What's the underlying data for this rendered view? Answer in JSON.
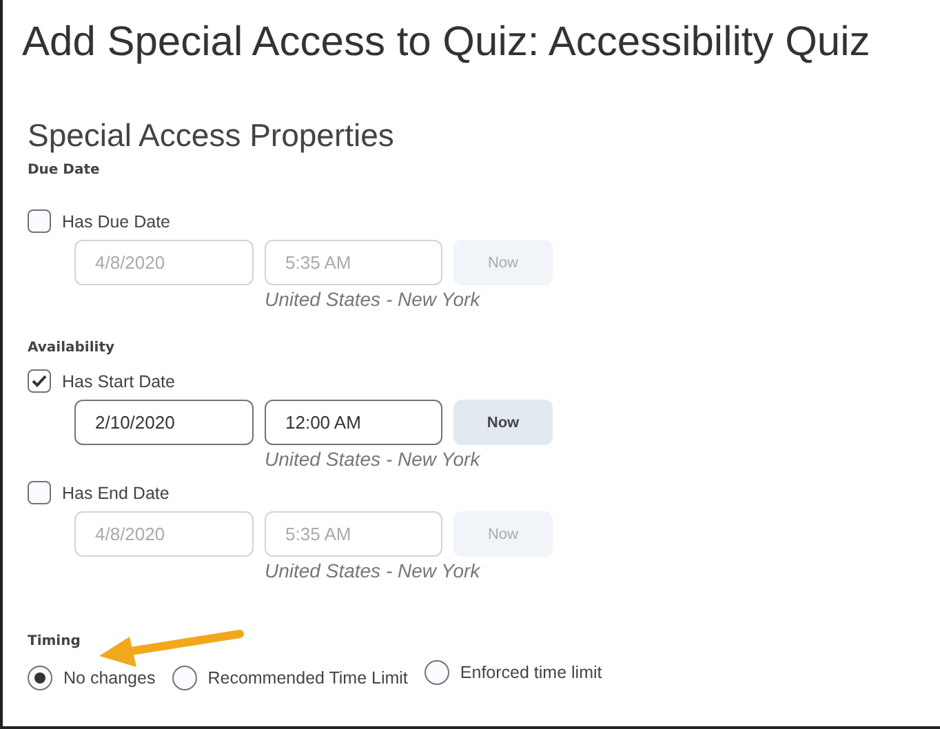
{
  "title": "Add Special Access to Quiz: Accessibility Quiz",
  "section_title": "Special Access Properties",
  "groups": [
    {
      "heading": "Due Date",
      "items": [
        {
          "label": "Has Due Date",
          "checked": false,
          "date": "4/8/2020",
          "time": "5:35 AM",
          "button": "Now",
          "timezone": "United States - New York"
        }
      ]
    },
    {
      "heading": "Availability",
      "items": [
        {
          "label": "Has Start Date",
          "checked": true,
          "date": "2/10/2020",
          "time": "12:00 AM",
          "button": "Now",
          "timezone": "United States - New York"
        },
        {
          "label": "Has End Date",
          "checked": false,
          "date": "4/8/2020",
          "time": "5:35 AM",
          "button": "Now",
          "timezone": "United States - New York"
        }
      ]
    }
  ],
  "timing": {
    "heading": "Timing",
    "options": [
      {
        "label": "No changes",
        "selected": true
      },
      {
        "label": "Recommended Time Limit",
        "selected": false
      },
      {
        "label": "Enforced time limit",
        "selected": false
      }
    ]
  }
}
